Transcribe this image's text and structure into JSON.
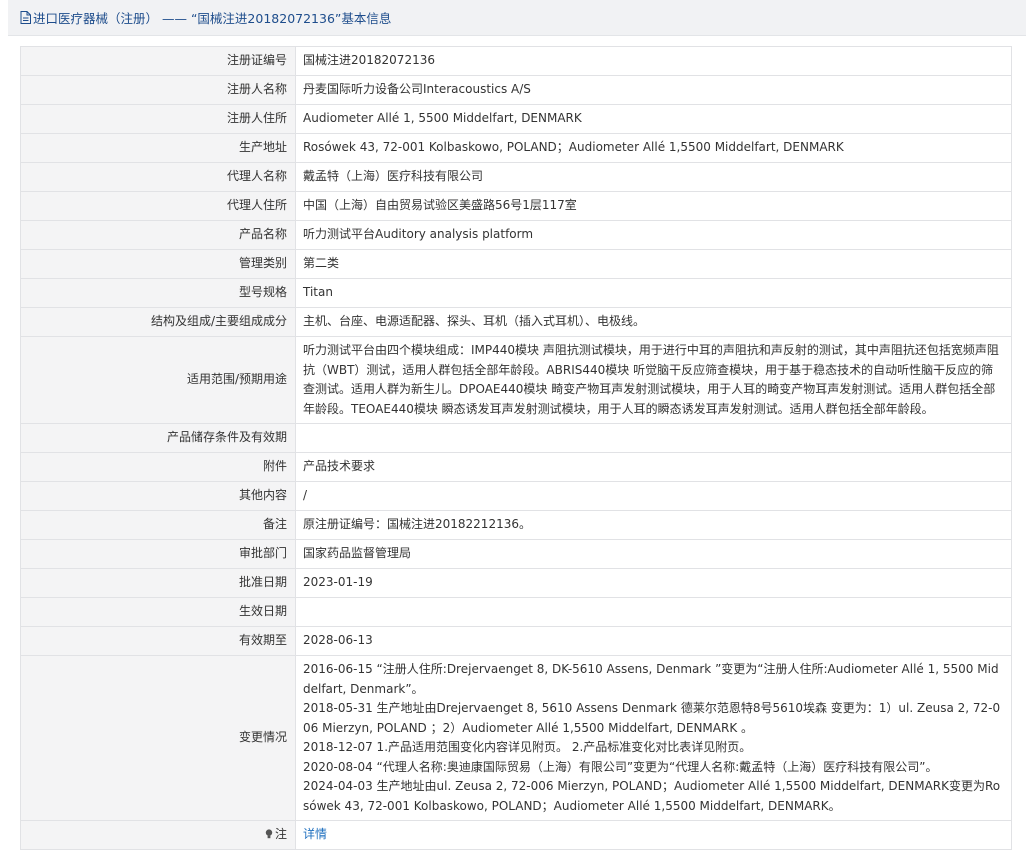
{
  "header": {
    "title": "进口医疗器械（注册） —— “国械注进20182072136”基本信息",
    "icon": "document-icon",
    "color": "#1e4d8c"
  },
  "fields": [
    {
      "key": "注册证编号",
      "value": "国械注进20182072136"
    },
    {
      "key": "注册人名称",
      "value": "丹麦国际听力设备公司Interacoustics A/S"
    },
    {
      "key": "注册人住所",
      "value": "Audiometer Allé 1, 5500 Middelfart, DENMARK"
    },
    {
      "key": "生产地址",
      "value": "Rosówek 43, 72-001 Kolbaskowo, POLAND；Audiometer Allé 1,5500 Middelfart, DENMARK"
    },
    {
      "key": "代理人名称",
      "value": "戴孟特（上海）医疗科技有限公司"
    },
    {
      "key": "代理人住所",
      "value": "中国（上海）自由贸易试验区美盛路56号1层117室"
    },
    {
      "key": "产品名称",
      "value": "听力测试平台Auditory analysis platform"
    },
    {
      "key": "管理类别",
      "value": "第二类"
    },
    {
      "key": "型号规格",
      "value": "Titan"
    },
    {
      "key": "结构及组成/主要组成成分",
      "value": "主机、台座、电源适配器、探头、耳机（插入式耳机）、电极线。"
    },
    {
      "key": "适用范围/预期用途",
      "value": "听力测试平台由四个模块组成：IMP440模块 声阻抗测试模块，用于进行中耳的声阻抗和声反射的测试，其中声阻抗还包括宽频声阻抗（WBT）测试，适用人群包括全部年龄段。ABRIS440模块 听觉脑干反应筛查模块，用于基于稳态技术的自动听性脑干反应的筛查测试。适用人群为新生儿。DPOAE440模块 畸变产物耳声发射测试模块，用于人耳的畸变产物耳声发射测试。适用人群包括全部年龄段。TEOAE440模块 瞬态诱发耳声发射测试模块，用于人耳的瞬态诱发耳声发射测试。适用人群包括全部年龄段。"
    },
    {
      "key": "产品储存条件及有效期",
      "value": ""
    },
    {
      "key": "附件",
      "value": "产品技术要求"
    },
    {
      "key": "其他内容",
      "value": "/"
    },
    {
      "key": "备注",
      "value": "原注册证编号：国械注进20182212136。"
    },
    {
      "key": "审批部门",
      "value": "国家药品监督管理局"
    },
    {
      "key": "批准日期",
      "value": "2023-01-19"
    },
    {
      "key": "生效日期",
      "value": ""
    },
    {
      "key": "有效期至",
      "value": "2028-06-13"
    }
  ],
  "changes": {
    "key": "变更情况",
    "lines": [
      "2016-06-15 “注册人住所:Drejervaenget 8, DK-5610 Assens, Denmark ”变更为“注册人住所:Audiometer Allé 1, 5500 Middelfart, Denmark”。",
      "2018-05-31 生产地址由Drejervaenget 8, 5610 Assens Denmark 德莱尔范恩特8号5610埃森 变更为：1）ul. Zeusa 2, 72-006 Mierzyn, POLAND ；2）Audiometer Allé 1,5500 Middelfart, DENMARK 。",
      "2018-12-07 1.产品适用范围变化内容详见附页。 2.产品标准变化对比表详见附页。",
      "2020-08-04 “代理人名称:奥迪康国际贸易（上海）有限公司”变更为“代理人名称:戴孟特（上海）医疗科技有限公司”。",
      "2024-04-03 生产地址由ul. Zeusa 2, 72-006 Mierzyn, POLAND；Audiometer Allé 1,5500 Middelfart, DENMARK变更为Rosówek 43, 72-001 Kolbaskowo, POLAND；Audiometer Allé 1,5500 Middelfart, DENMARK。"
    ]
  },
  "note": {
    "key": "注",
    "icon": "lightbulb-icon",
    "link_label": "详情",
    "link_color": "#1e6fbf"
  }
}
